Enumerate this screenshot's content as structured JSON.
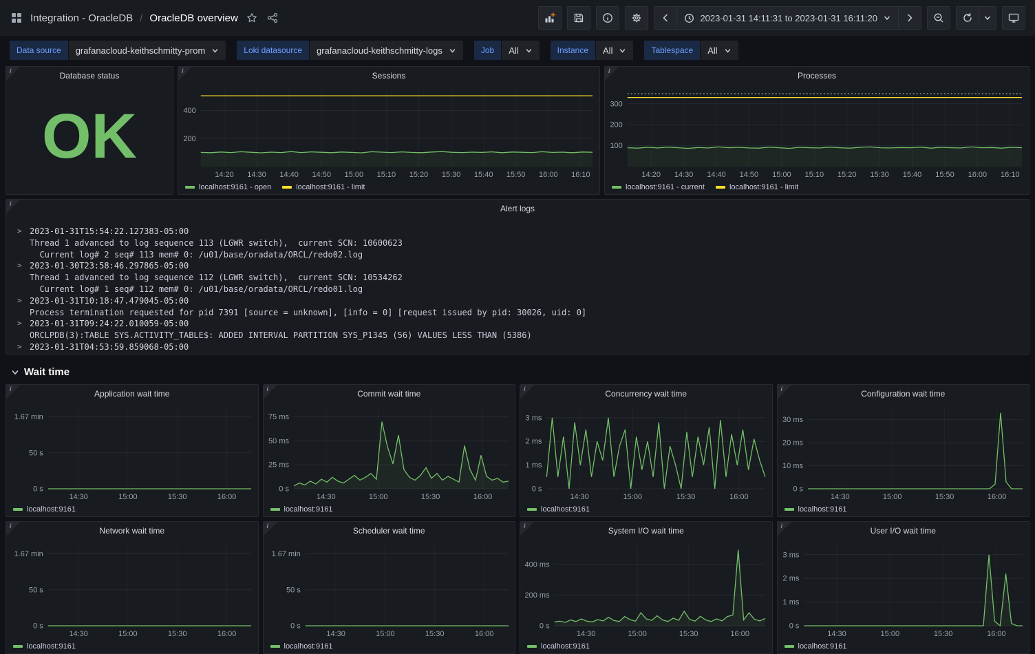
{
  "nav": {
    "breadcrumb": {
      "root": "Integration - OracleDB",
      "separator": "/",
      "page": "OracleDB overview"
    },
    "time_range_label": "2023-01-31 14:11:31 to 2023-01-31 16:11:20"
  },
  "icons": {
    "apps": "grid-squares",
    "star": "star-outline",
    "share": "share-nodes",
    "add_panel": "bar-chart-plus",
    "save": "floppy-disk",
    "info": "info-circle",
    "gear": "gear",
    "chevron_left": "chevron-left",
    "clock": "clock",
    "chevron_down": "chevron-down",
    "chevron_right": "chevron-right",
    "zoom_out": "magnifier-minus",
    "refresh": "refresh-arrow",
    "monitor": "monitor-kiosk",
    "panel_info": "i",
    "log_caret": ">"
  },
  "accents": {
    "add_plus": "#eb7b18",
    "variable_label": "#6e9fff"
  },
  "filters": {
    "datasource": {
      "label": "Data source",
      "value": "grafanacloud-keithschmitty-prom"
    },
    "loki": {
      "label": "Loki datasource",
      "value": "grafanacloud-keithschmitty-logs"
    },
    "job": {
      "label": "Job",
      "value": "All"
    },
    "instance": {
      "label": "Instance",
      "value": "All"
    },
    "tablespace": {
      "label": "Tablespace",
      "value": "All"
    }
  },
  "panels": {
    "database_status": {
      "title": "Database status",
      "value": "OK",
      "status_color": "#73bf69"
    },
    "alert_logs": {
      "title": "Alert logs",
      "entries": [
        {
          "timestamp": "2023-01-31T15:54:22.127383-05:00",
          "lines": [
            "Thread 1 advanced to log sequence 113 (LGWR switch),  current SCN: 10600623",
            "  Current log# 2 seq# 113 mem# 0: /u01/base/oradata/ORCL/redo02.log"
          ]
        },
        {
          "timestamp": "2023-01-30T23:58:46.297865-05:00",
          "lines": [
            "Thread 1 advanced to log sequence 112 (LGWR switch),  current SCN: 10534262",
            "  Current log# 1 seq# 112 mem# 0: /u01/base/oradata/ORCL/redo01.log"
          ]
        },
        {
          "timestamp": "2023-01-31T10:18:47.479045-05:00",
          "lines": [
            "Process termination requested for pid 7391 [source = unknown], [info = 0] [request issued by pid: 30026, uid: 0]"
          ]
        },
        {
          "timestamp": "2023-01-31T09:24:22.010059-05:00",
          "lines": [
            "ORCLPDB(3):TABLE SYS.ACTIVITY_TABLE$: ADDED INTERVAL PARTITION SYS_P1345 (56) VALUES LESS THAN (5386)"
          ]
        },
        {
          "timestamp": "2023-01-31T04:53:59.859068-05:00",
          "lines": []
        }
      ]
    }
  },
  "sections": {
    "wait_time": "Wait time"
  },
  "chart_data": [
    {
      "type": "line",
      "title": "Sessions",
      "x_ticks": [
        "14:20",
        "14:30",
        "14:40",
        "14:50",
        "15:00",
        "15:10",
        "15:20",
        "15:30",
        "15:40",
        "15:50",
        "16:00",
        "16:10"
      ],
      "x_tick_span": [
        0.06,
        0.97
      ],
      "y_ticks": [
        {
          "v": 200,
          "label": "200"
        },
        {
          "v": 400,
          "label": "400"
        }
      ],
      "ylim": [
        0,
        545
      ],
      "grid": true,
      "legend_position": "bottom",
      "series": [
        {
          "name": "localhost:9161 - open",
          "color": "#73bf69",
          "fill": true,
          "values": [
            101,
            99,
            104,
            100,
            106,
            102,
            98,
            103,
            100,
            107,
            100,
            105,
            102,
            99,
            104,
            101,
            98,
            106,
            103,
            100,
            105,
            101,
            99,
            104,
            107,
            102,
            100,
            103,
            101,
            105,
            99,
            104,
            102,
            100,
            106,
            101,
            103,
            99,
            104,
            102
          ]
        },
        {
          "name": "localhost:9161 - limit",
          "color": "#fade2a",
          "values": [
            505,
            505
          ]
        }
      ]
    },
    {
      "type": "line",
      "title": "Processes",
      "x_ticks": [
        "14:20",
        "14:30",
        "14:40",
        "14:50",
        "15:00",
        "15:10",
        "15:20",
        "15:30",
        "15:40",
        "15:50",
        "16:00",
        "16:10"
      ],
      "x_tick_span": [
        0.06,
        0.97
      ],
      "y_ticks": [
        {
          "v": 100,
          "label": "100"
        },
        {
          "v": 200,
          "label": "200"
        },
        {
          "v": 300,
          "label": "300"
        }
      ],
      "ylim": [
        0,
        365
      ],
      "grid": true,
      "legend_position": "bottom",
      "series": [
        {
          "name": "localhost:9161 - current",
          "color": "#73bf69",
          "fill": true,
          "values": [
            90,
            88,
            92,
            89,
            93,
            90,
            87,
            91,
            89,
            94,
            90,
            92,
            89,
            88,
            93,
            90,
            87,
            92,
            90,
            89,
            93,
            90,
            88,
            92,
            94,
            90,
            89,
            91,
            90,
            93,
            88,
            92,
            90,
            89,
            94,
            90,
            91,
            88,
            92,
            90
          ]
        },
        {
          "name": "localhost:9161 - limit",
          "color": "#fade2a",
          "values": [
            330,
            330
          ]
        },
        {
          "name": "limit threshold",
          "color": "#9aa5b8",
          "dash": "2,3",
          "legend": false,
          "values": [
            348,
            348
          ]
        }
      ]
    },
    {
      "type": "line",
      "title": "Application wait time",
      "x_ticks": [
        "14:30",
        "15:00",
        "15:30",
        "16:00"
      ],
      "x_tick_span": [
        0.15,
        0.88
      ],
      "y_ticks": [
        {
          "v": 0,
          "label": "0 s"
        },
        {
          "v": 50,
          "label": "50 s"
        },
        {
          "v": 100,
          "label": "1.67 min"
        }
      ],
      "ylim": [
        0,
        112
      ],
      "grid": true,
      "legend_position": "bottom",
      "series": [
        {
          "name": "localhost:9161",
          "color": "#73bf69",
          "values": [
            0,
            0
          ]
        }
      ]
    },
    {
      "type": "line",
      "title": "Commit wait time",
      "x_ticks": [
        "14:30",
        "15:00",
        "15:30",
        "16:00"
      ],
      "x_tick_span": [
        0.15,
        0.88
      ],
      "y_ticks": [
        {
          "v": 0,
          "label": "0 s"
        },
        {
          "v": 25,
          "label": "25 ms"
        },
        {
          "v": 50,
          "label": "50 ms"
        },
        {
          "v": 75,
          "label": "75 ms"
        }
      ],
      "ylim": [
        0,
        84
      ],
      "grid": true,
      "legend_position": "bottom",
      "series": [
        {
          "name": "localhost:9161",
          "color": "#73bf69",
          "fill": true,
          "values": [
            3,
            6,
            4,
            8,
            5,
            10,
            7,
            12,
            8,
            6,
            10,
            14,
            9,
            12,
            16,
            10,
            70,
            44,
            26,
            56,
            20,
            12,
            9,
            14,
            22,
            11,
            16,
            9,
            13,
            10,
            7,
            45,
            20,
            9,
            35,
            13,
            9,
            11,
            7,
            8
          ]
        }
      ]
    },
    {
      "type": "line",
      "title": "Concurrency wait time",
      "x_ticks": [
        "14:30",
        "15:00",
        "15:30",
        "16:00"
      ],
      "x_tick_span": [
        0.15,
        0.88
      ],
      "y_ticks": [
        {
          "v": 0,
          "label": "0 s"
        },
        {
          "v": 1,
          "label": "1 ms"
        },
        {
          "v": 2,
          "label": "2 ms"
        },
        {
          "v": 3,
          "label": "3 ms"
        }
      ],
      "ylim": [
        0,
        3.4
      ],
      "grid": true,
      "legend_position": "bottom",
      "series": [
        {
          "name": "localhost:9161",
          "color": "#73bf69",
          "values": [
            0.5,
            3,
            0.5,
            2.2,
            0,
            2.8,
            1,
            2.5,
            0.5,
            2,
            1.2,
            3,
            0.5,
            1.8,
            2.5,
            0,
            2.2,
            0.8,
            2,
            0.5,
            2.8,
            0,
            1.8,
            1,
            0,
            2.4,
            0.5,
            2.2,
            1,
            2.6,
            0,
            2.9,
            0.5,
            2.3,
            1,
            2.5,
            0.8,
            2.1,
            1.2,
            0.5
          ]
        }
      ]
    },
    {
      "type": "line",
      "title": "Configuration wait time",
      "x_ticks": [
        "14:30",
        "15:00",
        "15:30",
        "16:00"
      ],
      "x_tick_span": [
        0.15,
        0.88
      ],
      "y_ticks": [
        {
          "v": 0,
          "label": "0 s"
        },
        {
          "v": 10,
          "label": "10 ms"
        },
        {
          "v": 20,
          "label": "20 ms"
        },
        {
          "v": 30,
          "label": "30 ms"
        }
      ],
      "ylim": [
        0,
        35
      ],
      "grid": true,
      "legend_position": "bottom",
      "series": [
        {
          "name": "localhost:9161",
          "color": "#73bf69",
          "values": [
            0,
            0,
            0,
            0,
            0,
            0,
            0,
            0,
            0,
            0,
            0,
            0,
            0,
            0,
            0,
            0,
            0,
            0,
            0,
            0,
            0,
            0,
            0,
            0,
            0,
            0,
            0,
            0,
            0,
            0,
            0,
            0,
            0,
            0,
            2,
            33,
            3,
            0,
            0,
            0
          ]
        }
      ]
    },
    {
      "type": "line",
      "title": "Network wait time",
      "x_ticks": [
        "14:30",
        "15:00",
        "15:30",
        "16:00"
      ],
      "x_tick_span": [
        0.15,
        0.88
      ],
      "y_ticks": [
        {
          "v": 0,
          "label": "0 s"
        },
        {
          "v": 50,
          "label": "50 s"
        },
        {
          "v": 100,
          "label": "1.67 min"
        }
      ],
      "ylim": [
        0,
        112
      ],
      "grid": true,
      "legend_position": "bottom",
      "series": [
        {
          "name": "localhost:9161",
          "color": "#73bf69",
          "values": [
            0,
            0
          ]
        }
      ]
    },
    {
      "type": "line",
      "title": "Scheduler wait time",
      "x_ticks": [
        "14:30",
        "15:00",
        "15:30",
        "16:00"
      ],
      "x_tick_span": [
        0.15,
        0.88
      ],
      "y_ticks": [
        {
          "v": 0,
          "label": "0 s"
        },
        {
          "v": 50,
          "label": "50 s"
        },
        {
          "v": 100,
          "label": "1.67 min"
        }
      ],
      "ylim": [
        0,
        112
      ],
      "grid": true,
      "legend_position": "bottom",
      "series": [
        {
          "name": "localhost:9161",
          "color": "#73bf69",
          "values": [
            0,
            0
          ]
        }
      ]
    },
    {
      "type": "line",
      "title": "System I/O wait time",
      "x_ticks": [
        "14:30",
        "15:00",
        "15:30",
        "16:00"
      ],
      "x_tick_span": [
        0.15,
        0.88
      ],
      "y_ticks": [
        {
          "v": 0,
          "label": "0 s"
        },
        {
          "v": 200,
          "label": "200 ms"
        },
        {
          "v": 400,
          "label": "400 ms"
        }
      ],
      "ylim": [
        0,
        525
      ],
      "grid": true,
      "legend_position": "bottom",
      "series": [
        {
          "name": "localhost:9161",
          "color": "#73bf69",
          "fill": true,
          "values": [
            25,
            30,
            22,
            38,
            28,
            45,
            30,
            25,
            40,
            32,
            55,
            35,
            28,
            60,
            40,
            30,
            85,
            45,
            35,
            65,
            38,
            28,
            50,
            35,
            95,
            42,
            30,
            62,
            38,
            28,
            45,
            32,
            60,
            70,
            495,
            38,
            85,
            42,
            32,
            48
          ]
        }
      ]
    },
    {
      "type": "line",
      "title": "User I/O wait time",
      "x_ticks": [
        "14:30",
        "15:00",
        "15:30",
        "16:00"
      ],
      "x_tick_span": [
        0.15,
        0.88
      ],
      "y_ticks": [
        {
          "v": 0,
          "label": "0 s"
        },
        {
          "v": 1,
          "label": "1 ms"
        },
        {
          "v": 2,
          "label": "2 ms"
        },
        {
          "v": 3,
          "label": "3 ms"
        }
      ],
      "ylim": [
        0,
        3.4
      ],
      "grid": true,
      "legend_position": "bottom",
      "series": [
        {
          "name": "localhost:9161",
          "color": "#73bf69",
          "fill": true,
          "values": [
            0,
            0,
            0,
            0,
            0,
            0,
            0,
            0,
            0,
            0,
            0,
            0,
            0,
            0,
            0,
            0,
            0,
            0,
            0,
            0,
            0,
            0,
            0,
            0,
            0,
            0,
            0,
            0,
            0,
            0,
            0,
            0,
            0,
            3,
            0.2,
            0,
            2.2,
            0.1,
            0,
            0
          ]
        }
      ]
    }
  ]
}
